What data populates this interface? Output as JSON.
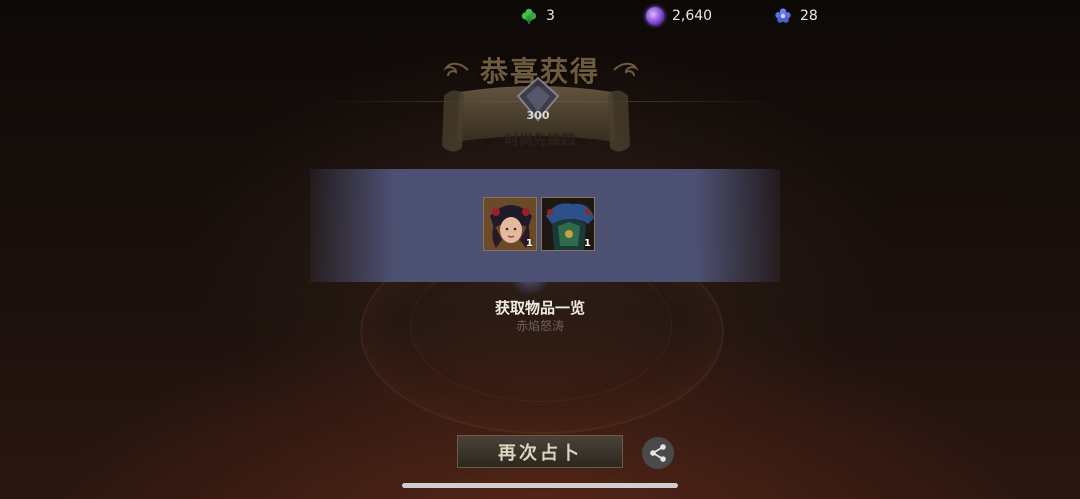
{
  "currency": {
    "clover": {
      "icon": "clover-icon",
      "value": "3",
      "color": "#3fbf4f"
    },
    "crystal": {
      "icon": "crystal-orb-icon",
      "value": "2,640",
      "color": "#8a4fe0"
    },
    "flower": {
      "icon": "blue-flower-icon",
      "value": "28",
      "color": "#5a6fe0"
    }
  },
  "header": {
    "title": "恭喜获得"
  },
  "banner": {
    "badge_value": "300",
    "name": "时尚先锋四"
  },
  "rewards": {
    "items": [
      {
        "icon": "character-portrait-icon",
        "count": "1"
      },
      {
        "icon": "armor-costume-icon",
        "count": "1"
      }
    ]
  },
  "list": {
    "title": "获取物品一览",
    "subtitle": "赤焰怒涛"
  },
  "actions": {
    "draw_again_label": "再次占卜",
    "share_icon": "share-icon"
  }
}
